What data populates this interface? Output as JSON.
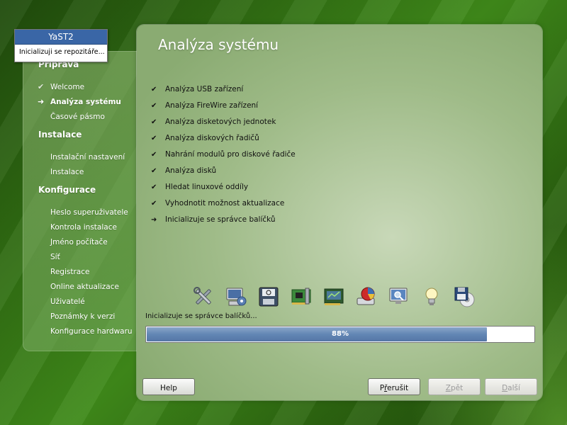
{
  "popup": {
    "title": "YaST2",
    "message": "Inicializuji se repozitáře..."
  },
  "sidebar": {
    "sections": [
      {
        "title": "Příprava",
        "items": [
          {
            "label": "Welcome",
            "state": "done"
          },
          {
            "label": "Analýza systému",
            "state": "current"
          },
          {
            "label": "Časové pásmo",
            "state": "pending"
          }
        ]
      },
      {
        "title": "Instalace",
        "items": [
          {
            "label": "Instalační nastavení",
            "state": "pending"
          },
          {
            "label": "Instalace",
            "state": "pending"
          }
        ]
      },
      {
        "title": "Konfigurace",
        "items": [
          {
            "label": "Heslo superuživatele",
            "state": "pending"
          },
          {
            "label": "Kontrola instalace",
            "state": "pending"
          },
          {
            "label": "Jméno počítače",
            "state": "pending"
          },
          {
            "label": "Síť",
            "state": "pending"
          },
          {
            "label": "Registrace",
            "state": "pending"
          },
          {
            "label": "Online aktualizace",
            "state": "pending"
          },
          {
            "label": "Uživatelé",
            "state": "pending"
          },
          {
            "label": "Poznámky k verzi",
            "state": "pending"
          },
          {
            "label": "Konfigurace hardwaru",
            "state": "pending"
          }
        ]
      }
    ]
  },
  "main": {
    "title": "Analýza systému",
    "steps": [
      {
        "label": "Analýza USB zařízení",
        "status": "done"
      },
      {
        "label": "Analýza FireWire zařízení",
        "status": "done"
      },
      {
        "label": "Analýza disketových jednotek",
        "status": "done"
      },
      {
        "label": "Analýza diskových řadičů",
        "status": "done"
      },
      {
        "label": "Nahrání modulů pro diskové řadiče",
        "status": "done"
      },
      {
        "label": "Analýza disků",
        "status": "done"
      },
      {
        "label": "Hledat linuxové oddíly",
        "status": "done"
      },
      {
        "label": "Vyhodnotit možnost aktualizace",
        "status": "done"
      },
      {
        "label": "Inicializuje se správce balíčků",
        "status": "in-progress"
      }
    ],
    "icons": [
      "tools-icon",
      "computer-gear-icon",
      "power-switch-icon",
      "network-card-icon",
      "graphics-card-icon",
      "disk-pie-icon",
      "monitor-search-icon",
      "lightbulb-icon",
      "floppy-cd-icon"
    ],
    "progress": {
      "label": "Inicializuje se správce balíčků...",
      "value": 88,
      "text": "88%"
    }
  },
  "buttons": {
    "help": "Help",
    "abort": {
      "before": "P",
      "underline": "ř",
      "after": "erušit"
    },
    "back": {
      "before": "",
      "underline": "Z",
      "after": "pět"
    },
    "next": {
      "before": "",
      "underline": "D",
      "after": "alší"
    }
  },
  "colors": {
    "background_green": "#2f6a12",
    "panel_green": "#9fbb88",
    "popup_title_blue": "#3a66a6",
    "progress_blue": "#6286b4"
  }
}
